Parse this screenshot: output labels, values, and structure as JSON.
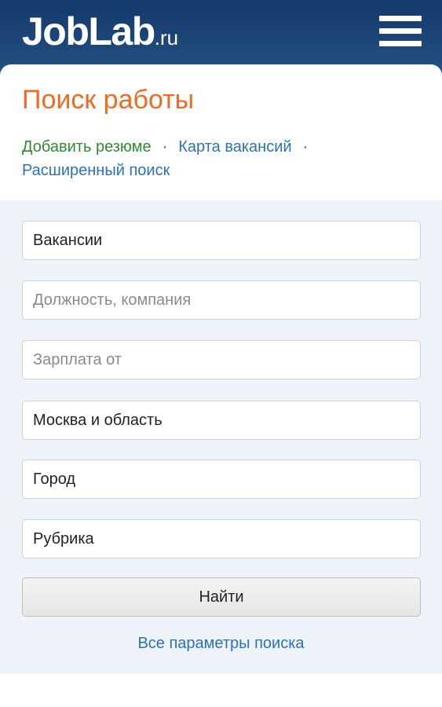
{
  "header": {
    "logo_main": "JobLab",
    "logo_suffix": ".ru",
    "menu_icon": "hamburger-menu-icon"
  },
  "page": {
    "title": "Поиск работы"
  },
  "links": {
    "add_resume": "Добавить резюме",
    "separator": "·",
    "vacancy_map": "Карта вакансий",
    "advanced_search": "Расширенный поиск"
  },
  "form": {
    "type_value": "Вакансии",
    "position_placeholder": "Должность, компания",
    "salary_placeholder": "Зарплата от",
    "region_value": "Москва и область",
    "city_value": "Город",
    "category_value": "Рубрика",
    "submit_label": "Найти",
    "all_params_label": "Все параметры поиска"
  },
  "colors": {
    "header_bg": "#1b4677",
    "title": "#f26a21",
    "link_green": "#2e8b2e",
    "link_blue": "#2a73b8",
    "form_bg": "#edf3f9"
  }
}
